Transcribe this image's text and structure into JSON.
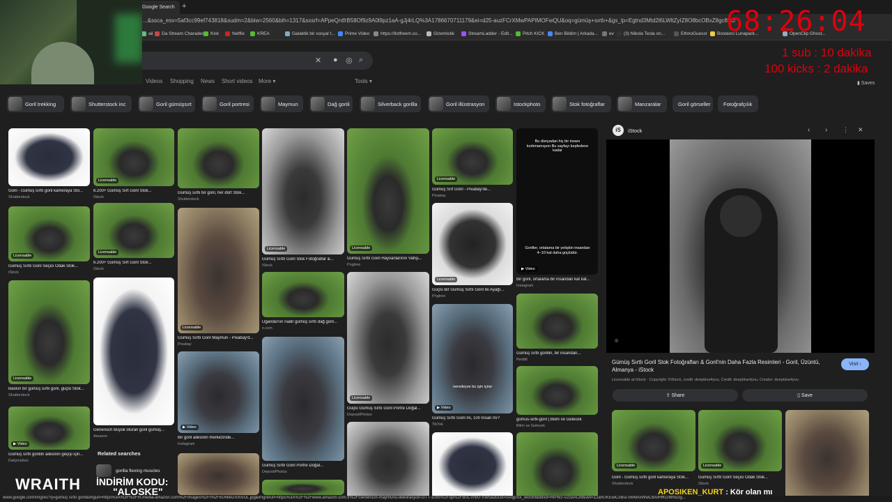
{
  "browser": {
    "tab_title": "Google Search",
    "url": "...&ssca_esv=5af3cc99ef743818&sudm=2&biw=2560&bih=1317&sxsrf=APpeQntfrB58Of9z9A0l9pz1aA-gJj4rLQ%3A1786670711179&ei=d25-auzFCrXMwPAPIMOFwQU&oq=gümüş+sırtlı+&gs_lp=Egtnd3Mtd2l6LWltZyIZ8O8bcOBxZ8gc8ScxnRsxLEgKgIIADIFEAAYgAQyBBAAGE..."
  },
  "bookmarks": [
    {
      "label": "ail"
    },
    {
      "label": "Da Stream Charades"
    },
    {
      "label": "Kick"
    },
    {
      "label": "Netflix"
    },
    {
      "label": "KREA"
    },
    {
      "label": "Galaktik bir sosyal t..."
    },
    {
      "label": "Prime Video"
    },
    {
      "label": "https://listfreem.co..."
    },
    {
      "label": "Gizemistik"
    },
    {
      "label": "StreamLadder - Edit..."
    },
    {
      "label": "Pitch KICK"
    },
    {
      "label": "Ben Bildim | Arkada..."
    },
    {
      "label": "ev"
    },
    {
      "label": "(3) Nikola Tesla on..."
    },
    {
      "label": "EthnoGuessr"
    },
    {
      "label": "Bostanci Lunapark..."
    },
    {
      "label": "OpenClip Ghost..."
    }
  ],
  "search": {
    "nav_tabs": [
      "Videos",
      "Shopping",
      "News",
      "Short videos",
      "More ▾"
    ],
    "tools": "Tools ▾",
    "saves": "Saves",
    "chips": [
      "Goril trekking",
      "Shutterstock inc",
      "Goril gümüşsırt",
      "Goril portresi",
      "Maymun",
      "Dağ gorili",
      "Silverback gorilla",
      "Goril illüstrasyon",
      "Istockphoto",
      "Stok fotoğraflar",
      "Manzaralar",
      "Goril görseller",
      "Fotoğrafçılık"
    ]
  },
  "results": [
    {
      "caption": "Goril - Gümüş sırtlı goril kameraya Sto...",
      "source": "Shutterstock",
      "licensable": false
    },
    {
      "caption": "Gümüş Sırtlı Goril Seçici Odak Stok...",
      "source": "iStock",
      "licensable": true
    },
    {
      "caption": "Baskın bir gümüş sırtlı goril, güçlü Stok...",
      "source": "Shutterstock",
      "licensable": true
    },
    {
      "caption": "Gümüş sırtlı gorillin ailesinin geçişi için...",
      "source": "Dailymotion",
      "licensable": false,
      "video": true
    },
    {
      "caption": "6.200+ Gümüş Sırt Goril Stok...",
      "source": "iStock",
      "licensable": true
    },
    {
      "caption": "6.200+ Gümüş Sırt Goril Stok...",
      "source": "iStock",
      "licensable": true
    },
    {
      "caption": "Generisch Büyük oturan goril gümüş...",
      "source": "Amazon",
      "licensable": false
    },
    {
      "caption": "Gümüş sırtlı bir goril, her dört Stok...",
      "source": "Shutterstock",
      "licensable": false
    },
    {
      "caption": "Gümüş Sırtlı Goril Maymun - Pixabay'd...",
      "source": "Pixabay",
      "licensable": true
    },
    {
      "caption": "Bir goril ailesinin merkezinde...",
      "source": "Instagram",
      "licensable": false,
      "video": true
    },
    {
      "caption": "Gümüş Sırtlı Goril Stok Fotoğraflar &...",
      "source": "iStock",
      "licensable": true
    },
    {
      "caption": "Uganda'nın nadir gümüş sırtlı dağ goril...",
      "source": "x.com",
      "licensable": false
    },
    {
      "caption": "Gümüş Sırtlı Goril Portre Doğal...",
      "source": "DepositPhotos",
      "licensable": false
    },
    {
      "caption": "Gümüş Sırtlı Goril Hayvanlarının Vahşi...",
      "source": "Pngtree",
      "licensable": true
    },
    {
      "caption": "Güçlü Gümüş Sırtlı Goril Portre Doğal...",
      "source": "DepositPhotos",
      "licensable": true
    },
    {
      "caption": "Gümüş Sırt Goril - Pixabay'de...",
      "source": "Pixabay",
      "licensable": true
    },
    {
      "caption": "Güçlü Bir Gümüş Sırtlı Goril İki Ayağı...",
      "source": "Pngtree",
      "licensable": true
    },
    {
      "caption": "Gümüş Sırtlı Goril mi, 100 İnsan mı?",
      "source": "TikTok",
      "licensable": false,
      "video": true
    },
    {
      "caption": "Bir goril, ortalama bir insandan kat kat...",
      "source": "Instagram",
      "licensable": false,
      "video": true
    },
    {
      "caption": "Gümüş sırtlı gorillin, bir insandan...",
      "source": "Reddit",
      "licensable": false
    },
    {
      "caption": "gumus-sirtli-goril | Bilim ve Gelecek",
      "source": "Bilim ve Gelecek",
      "licensable": false
    }
  ],
  "related": {
    "title": "Related searches",
    "items": [
      "gorilla flexing muscles"
    ]
  },
  "overlay_texts": {
    "insta_text": "Bu dünyadan hiç bir insanı korkmamışsın Bu sayfayı keşfedene kadar",
    "insta_caption": "Goriller, ortalama bir yetişkin insandan 4–10 kat daha güçlüdür.",
    "tiktok_caption": "neredeyse bu işin içine"
  },
  "panel": {
    "source_name": "iStock",
    "title": "Gümüş Sırtlı Goril Stok Fotoğrafları & Goril'nin Daha Fazla Resimleri - Goril, Üzüntü, Almanya - iStock",
    "licensable_line": "Licensable at iStock  ·  Copyright: ©iStock, credit: deepblue4you, Credit: deepblue4you, Creator: deepblue4you",
    "visit": "Visit ›",
    "share": "Share",
    "save": "Save",
    "thumbs": [
      {
        "caption": "Goril - Gümüş sırtlı goril kameraya Stok...",
        "source": "Shutterstock",
        "licensable": true
      },
      {
        "caption": "Gümüş Sırtlı Goril Seçici Odak Stok...",
        "source": "iStock",
        "licensable": true
      },
      {
        "caption": "",
        "source": "",
        "licensable": false
      }
    ]
  },
  "stream_overlay": {
    "timer": "68:26:04",
    "rule1": "1 sub : 10 dakika",
    "rule2": "100 kicks : 2 dakika",
    "watermark": "WRAITH",
    "promo_line1": "İNDİRİM KODU:",
    "promo_line2": "\"ALOSKE\"",
    "chat_user": "APOSIKEN_KURT",
    "chat_msg": ": Kör olan mı",
    "accent_red": "#e0000c",
    "chat_user_color": "#f2d21b"
  },
  "status_url": "www.google.com/imgres?q=gümüş sırtlı goril&imgurl=https%3A%2F%2Fm.media-amazon.com%2Fimages%2FI%2F61RkkGXmSUL.jpg&imgrefurl=https%3A%2F%2Fwww.amazon.com.tr%2FGenerisch-maymunu-dekorasyon-GTT-1085%2Fdp%2FB0CVNKFXW5&docid=0AfgoSx_eloSM&tbnid=HrPbcI-v22eACM&vet=12ahUKEwiCsBui-S6WAxWwCBAIHfKOMhsOg..."
}
